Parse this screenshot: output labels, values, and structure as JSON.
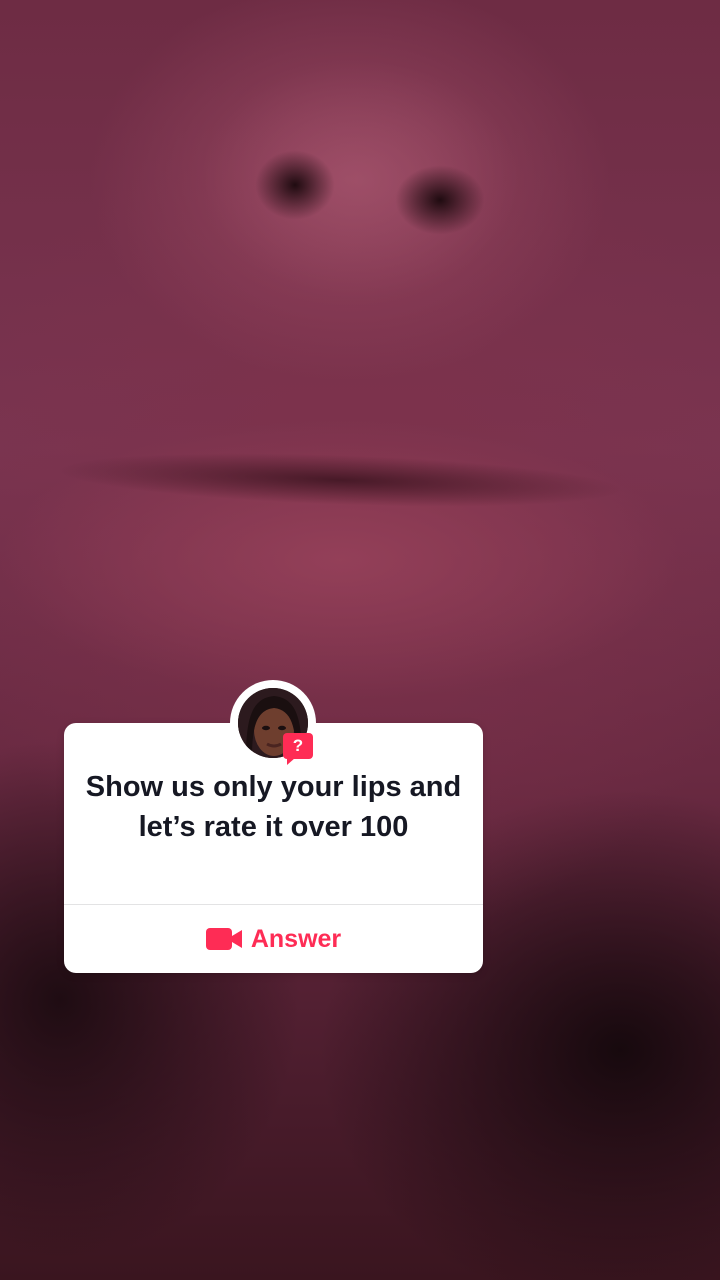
{
  "question": {
    "text": "Show us only your lips and let’s rate it over 100",
    "badge_symbol": "?",
    "avatar_icon": "user-avatar",
    "accent_color": "#fe2c55"
  },
  "answer": {
    "label": "Answer",
    "icon": "video-camera-icon"
  }
}
